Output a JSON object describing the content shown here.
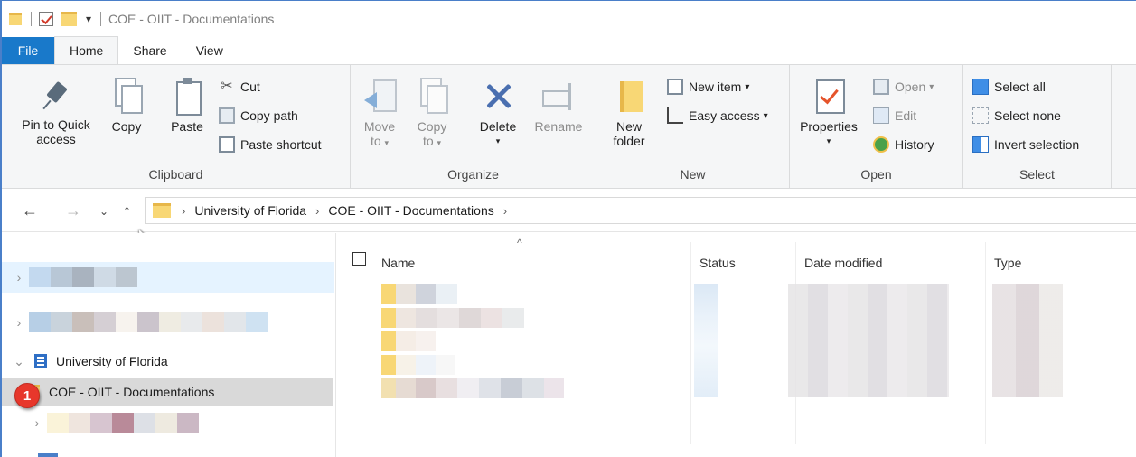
{
  "window": {
    "title": "COE - OIIT - Documentations"
  },
  "tabs": [
    {
      "label": "File"
    },
    {
      "label": "Home"
    },
    {
      "label": "Share"
    },
    {
      "label": "View"
    }
  ],
  "ribbon": {
    "clipboard": {
      "label": "Clipboard",
      "pin_line1": "Pin to Quick",
      "pin_line2": "access",
      "copy": "Copy",
      "paste": "Paste",
      "cut": "Cut",
      "copy_path": "Copy path",
      "paste_shortcut": "Paste shortcut"
    },
    "organize": {
      "label": "Organize",
      "move_line1": "Move",
      "move_line2": "to",
      "copy_line1": "Copy",
      "copy_line2": "to",
      "delete": "Delete",
      "rename": "Rename"
    },
    "new": {
      "label": "New",
      "new_folder_line1": "New",
      "new_folder_line2": "folder",
      "new_item": "New item",
      "easy_access": "Easy access"
    },
    "open": {
      "label": "Open",
      "properties": "Properties",
      "open": "Open",
      "edit": "Edit",
      "history": "History"
    },
    "select": {
      "label": "Select",
      "select_all": "Select all",
      "select_none": "Select none",
      "invert_selection": "Invert selection"
    }
  },
  "address": {
    "crumbs": [
      "University of Florida",
      "COE - OIIT - Documentations"
    ]
  },
  "navpane": {
    "university": "University of Florida",
    "selected_folder": "COE - OIIT - Documentations",
    "badge": "1"
  },
  "filelist": {
    "columns": [
      "Name",
      "Status",
      "Date modified",
      "Type"
    ]
  },
  "colors": {
    "accent": "#1979ca",
    "selection": "#d9d9d9",
    "hover": "#e5f3ff",
    "badge": "#e7372b",
    "folder": "#f8d775"
  }
}
